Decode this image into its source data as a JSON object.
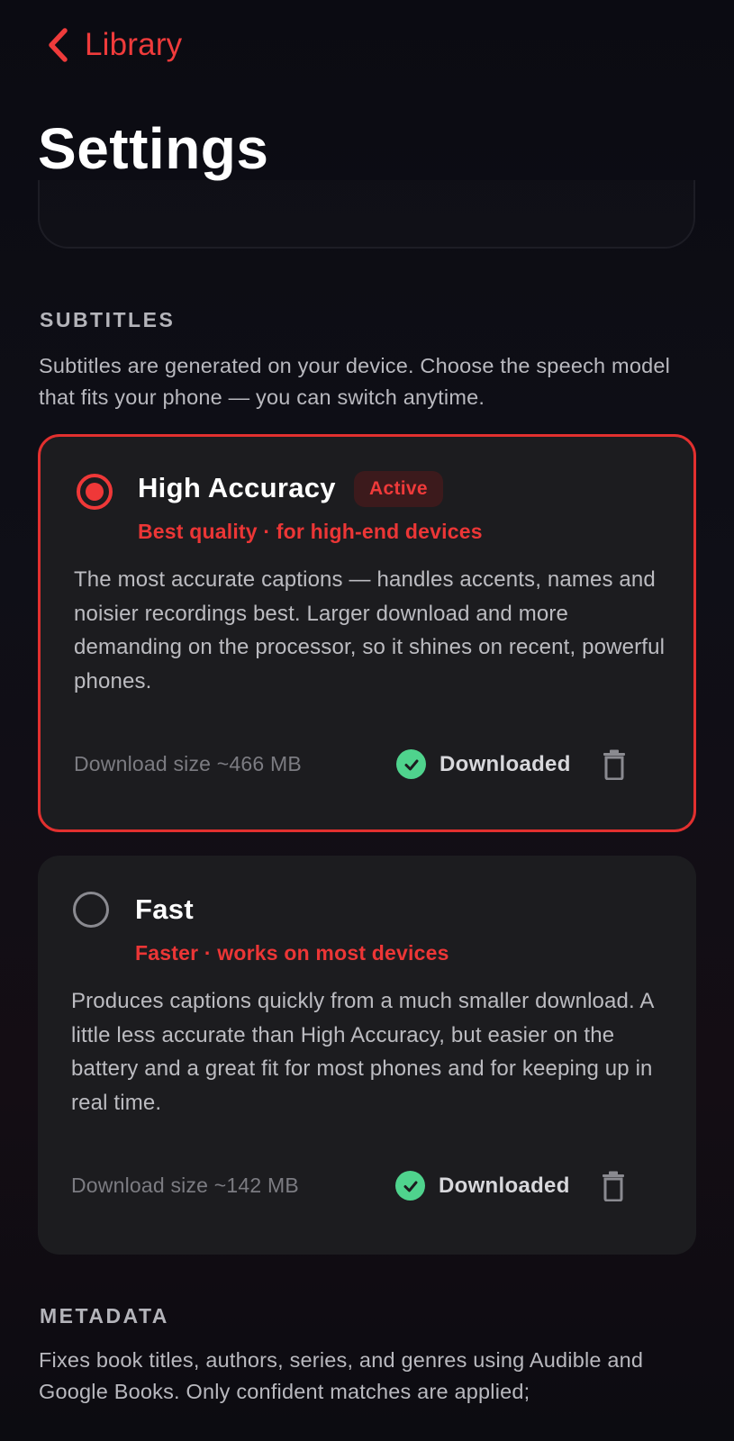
{
  "nav": {
    "back_label": "Library"
  },
  "page": {
    "title": "Settings"
  },
  "subtitles": {
    "heading": "SUBTITLES",
    "description": "Subtitles are generated on your device. Choose the speech model that fits your phone — you can switch anytime.",
    "models": [
      {
        "name": "High Accuracy",
        "badge": "Active",
        "tagline": "Best quality · for high-end devices",
        "description": "The most accurate captions — handles accents, names and noisier recordings best. Larger download and more demanding on the processor, so it shines on recent, powerful phones.",
        "download_size": "Download size ~466 MB",
        "status": "Downloaded",
        "selected": true
      },
      {
        "name": "Fast",
        "tagline": "Faster · works on most devices",
        "description": "Produces captions quickly from a much smaller download. A little less accurate than High Accuracy, but easier on the battery and a great fit for most phones and for keeping up in real time.",
        "download_size": "Download size ~142 MB",
        "status": "Downloaded",
        "selected": false
      }
    ]
  },
  "metadata": {
    "heading": "METADATA",
    "description": "Fixes book titles, authors, series, and genres using Audible and Google Books. Only confident matches are applied;"
  },
  "colors": {
    "accent": "#ef3838",
    "success": "#4fd38d",
    "card_bg": "#1c1c1f",
    "background": "#0d0d14"
  },
  "icons": {
    "back": "chevron-left-icon",
    "selected_radio": "radio-selected-icon",
    "unselected_radio": "radio-unselected-icon",
    "status": "check-circle-icon",
    "delete": "trash-icon"
  }
}
